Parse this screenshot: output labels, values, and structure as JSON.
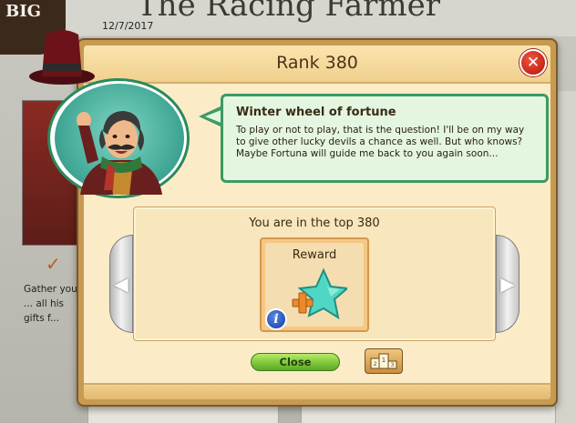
{
  "background": {
    "title": "The Racing Farmer",
    "date": "12/7/2017",
    "logo_text": "BIG",
    "body_text": "Gather your ... all his gifts f... famous gift"
  },
  "dialog": {
    "title": "Rank 380",
    "close_icon": "close-x-icon",
    "bubble": {
      "title": "Winter wheel of fortune",
      "text": "To play or not to play, that is the question! I'll be on my way to give other lucky devils a chance as well. But who knows? Maybe Fortuna will guide me back to you again soon..."
    },
    "rank_line": "You are in the top 380",
    "reward": {
      "label": "Reward",
      "icon": "star-plus-icon",
      "info_icon_glyph": "i"
    },
    "close_button_label": "Close",
    "nav_left_glyph": "◀",
    "nav_right_glyph": "▶"
  },
  "colors": {
    "dialog_frame": "#c79a52",
    "dialog_body": "#fbecc7",
    "bubble_border": "#3c9a62",
    "bubble_bg": "#e4f6e0",
    "close_button": "#7ec63a",
    "close_x": "#c9241a",
    "star": "#4fd6c4",
    "plus": "#ea8a2a"
  }
}
